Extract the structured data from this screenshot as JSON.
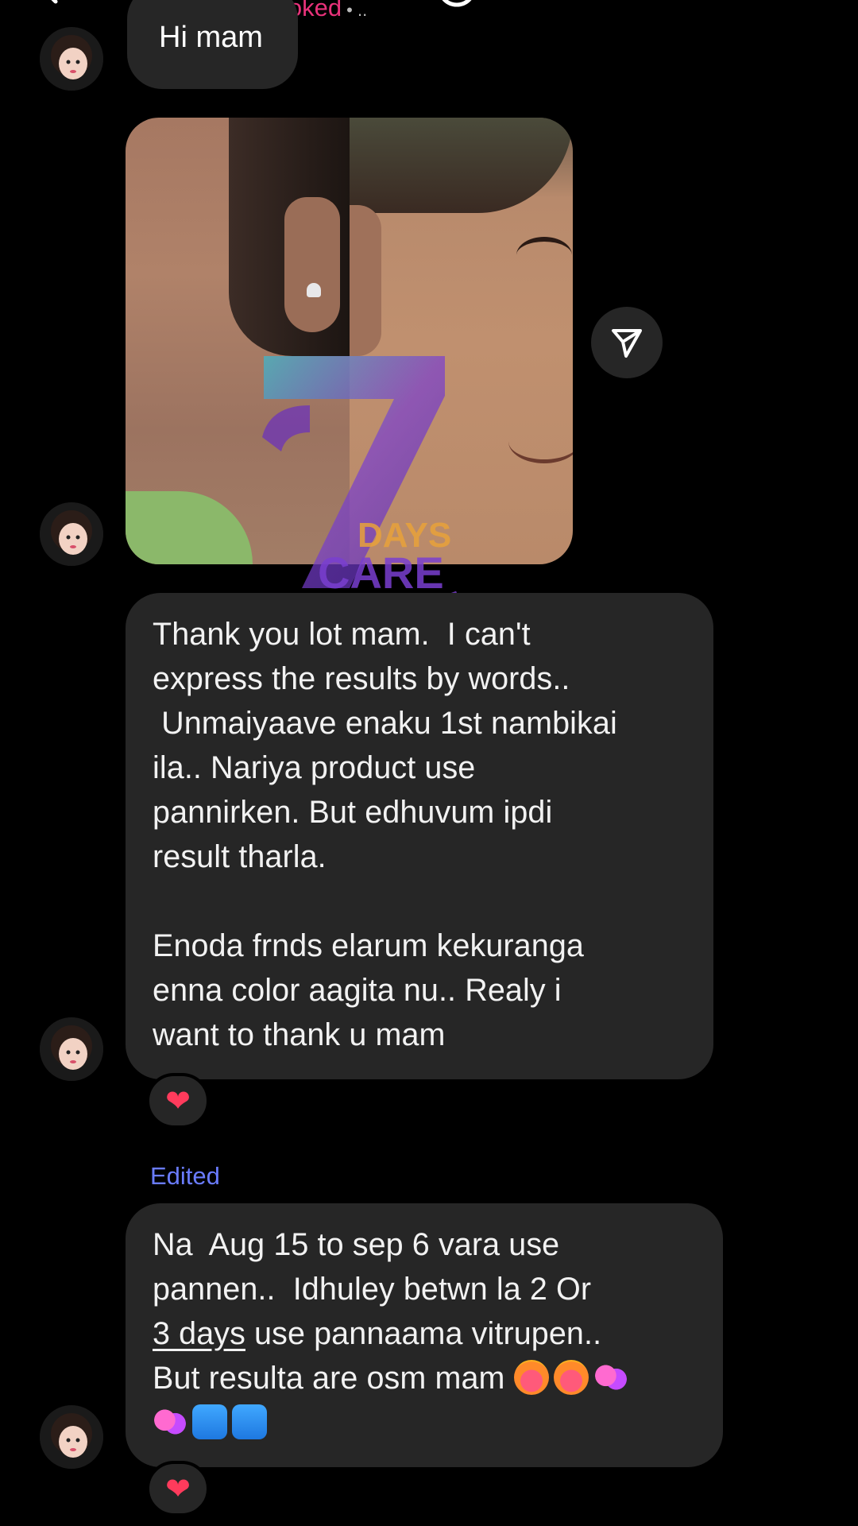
{
  "header": {
    "status": "Booked",
    "status_dots": "• ..",
    "icons": [
      "back-icon",
      "smiley-icon",
      "phone-icon",
      "video-icon",
      "tag-icon"
    ]
  },
  "messages": {
    "partial_top_text": "Hi mam",
    "photo": {
      "share_icon": "paper-plane-icon"
    },
    "watermark": {
      "number": "7",
      "line1": "DAYS",
      "line2": "CARE"
    },
    "bubble1": {
      "text": "Thank you lot mam.  I can't\nexpress the results by words..\n Unmaiyaave enaku 1st nambikai\nila.. Nariya product use\npannirken. But edhuvum ipdi\nresult tharla.\n\nEnoda frnds elarum kekuranga\nenna color aagita nu.. Realy i\nwant to thank u mam",
      "reaction": "❤"
    },
    "edited_label": "Edited",
    "bubble2": {
      "line1": "Na  Aug 15 to sep 6 vara use",
      "line2": "pannen..  Idhuley betwn la 2 Or",
      "line3_link": "3 days",
      "line3_rest": " use pannaama vitrupen..",
      "line4": "But resulta are osm mam ",
      "emojis": [
        "heart-on-fire",
        "heart-on-fire",
        "revolving-hearts",
        "revolving-hearts",
        "people",
        "people"
      ],
      "reaction": "❤"
    }
  }
}
